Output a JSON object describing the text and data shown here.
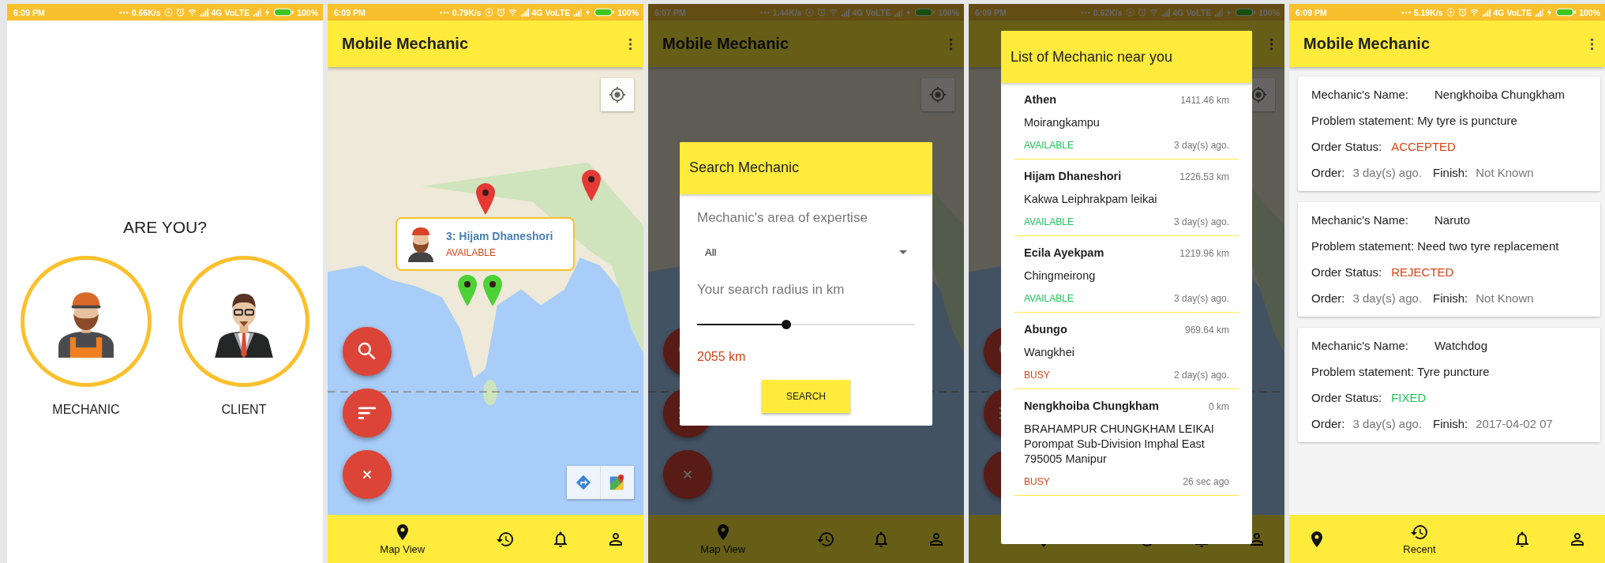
{
  "screens": [
    {
      "kind": "role_select",
      "status_bar": {
        "time": "6:09 PM",
        "speed": "0.66K/s",
        "network": "4G VoLTE",
        "battery": "100%"
      },
      "heading": "ARE YOU?",
      "roles": [
        {
          "kind": "mechanic",
          "label": "MECHANIC"
        },
        {
          "kind": "client",
          "label": "CLIENT"
        }
      ]
    },
    {
      "kind": "map",
      "status_bar": {
        "time": "6:09 PM",
        "speed": "0.79K/s",
        "network": "4G VoLTE",
        "battery": "100%"
      },
      "app_bar": {
        "title": "Mobile Mechanic"
      },
      "markers": [
        {
          "color": "#e53935"
        },
        {
          "color": "#e53935"
        },
        {
          "color": "#4cd137"
        },
        {
          "color": "#4cd137"
        }
      ],
      "info_window": {
        "title": "3: Hijam Dhaneshori",
        "status": "AVAILABLE"
      },
      "nav": [
        {
          "kind": "map",
          "label": "Map View",
          "selected": true
        },
        {
          "kind": "recent",
          "selected": false
        },
        {
          "kind": "alerts",
          "selected": false
        },
        {
          "kind": "profile",
          "selected": false
        }
      ]
    },
    {
      "kind": "map",
      "status_bar": {
        "time": "6:07 PM",
        "speed": "1.44K/s",
        "network": "4G VoLTE",
        "battery": "100%"
      },
      "app_bar": {
        "title": "Mobile Mechanic"
      },
      "nav": [
        {
          "kind": "map",
          "label": "Map View",
          "selected": true
        },
        {
          "kind": "recent",
          "selected": false
        },
        {
          "kind": "alerts",
          "selected": false
        },
        {
          "kind": "profile",
          "selected": false
        }
      ],
      "dialog": {
        "kind": "search",
        "title": "Search Mechanic",
        "expertise_label": "Mechanic's area of expertise",
        "expertise_value": "All",
        "radius_label": "Your search radius in km",
        "radius": {
          "level": 0.41
        },
        "radius_value": "2055 km",
        "button": "SEARCH"
      }
    },
    {
      "kind": "map",
      "status_bar": {
        "time": "6:09 PM",
        "speed": "0.62K/s",
        "network": "4G VoLTE",
        "battery": "100%"
      },
      "nav": [
        {
          "kind": "map",
          "selected": true
        },
        {
          "kind": "recent",
          "selected": false
        },
        {
          "kind": "alerts",
          "selected": false
        },
        {
          "kind": "profile",
          "selected": false
        }
      ],
      "dialog": {
        "kind": "list",
        "title": "List of Mechanic near you",
        "items": [
          {
            "name": "Athen",
            "distance": "1411.46 km",
            "address": "Moirangkampu",
            "status": {
              "label": "AVAILABLE",
              "color": "#1fc25a"
            },
            "time": "3 day(s) ago."
          },
          {
            "name": "Hijam Dhaneshori",
            "distance": "1226.53 km",
            "address": "Kakwa Leiphrakpam leikai",
            "status": {
              "label": "AVAILABLE",
              "color": "#1fc25a"
            },
            "time": "3 day(s) ago."
          },
          {
            "name": "Ecila Ayekpam",
            "distance": "1219.96 km",
            "address": "Chingmeirong",
            "status": {
              "label": "AVAILABLE",
              "color": "#1fc25a"
            },
            "time": "3 day(s) ago."
          },
          {
            "name": "Abungo",
            "distance": "969.64 km",
            "address": "Wangkhei",
            "status": {
              "label": "BUSY",
              "color": "#d84315"
            },
            "time": "2 day(s) ago."
          },
          {
            "name": "Nengkhoiba Chungkham",
            "distance": "0 km",
            "address": "BRAHAMPUR CHUNGKHAM LEIKAI Porompat Sub-Division Imphal East 795005 Manipur",
            "status": {
              "label": "BUSY",
              "color": "#d84315"
            },
            "time": "26 sec ago"
          }
        ]
      }
    },
    {
      "kind": "orders",
      "status_bar": {
        "time": "6:09 PM",
        "speed": "5.19K/s",
        "network": "4G VoLTE",
        "battery": "100%"
      },
      "app_bar": {
        "title": "Mobile Mechanic"
      },
      "orders": [
        {
          "name_label": "Mechanic's Name:",
          "name": "Nengkhoiba Chungkham",
          "problem": "Problem statement: My tyre is puncture",
          "status_label": "Order Status:",
          "status": {
            "label": "ACCEPTED",
            "color": "#d84315"
          },
          "order_label": "Order:",
          "order": "3 day(s) ago.",
          "finish_label": "Finish:",
          "finish": "Not Known"
        },
        {
          "name_label": "Mechanic's Name:",
          "name": "Naruto",
          "problem": "Problem statement: Need two tyre replacement",
          "status_label": "Order Status:",
          "status": {
            "label": "REJECTED",
            "color": "#d84315"
          },
          "order_label": "Order:",
          "order": "3 day(s) ago.",
          "finish_label": "Finish:",
          "finish": "Not Known"
        },
        {
          "name_label": "Mechanic's Name:",
          "name": "Watchdog",
          "problem": "Problem statement: Tyre puncture",
          "status_label": "Order Status:",
          "status": {
            "label": "FIXED",
            "color": "#1fc25a"
          },
          "order_label": "Order:",
          "order": "3 day(s) ago.",
          "finish_label": "Finish:",
          "finish": "2017-04-02 07"
        }
      ],
      "nav": [
        {
          "kind": "map",
          "selected": false
        },
        {
          "kind": "recent",
          "label": "Recent",
          "selected": true
        },
        {
          "kind": "alerts",
          "selected": false
        },
        {
          "kind": "profile",
          "selected": false
        }
      ]
    }
  ]
}
